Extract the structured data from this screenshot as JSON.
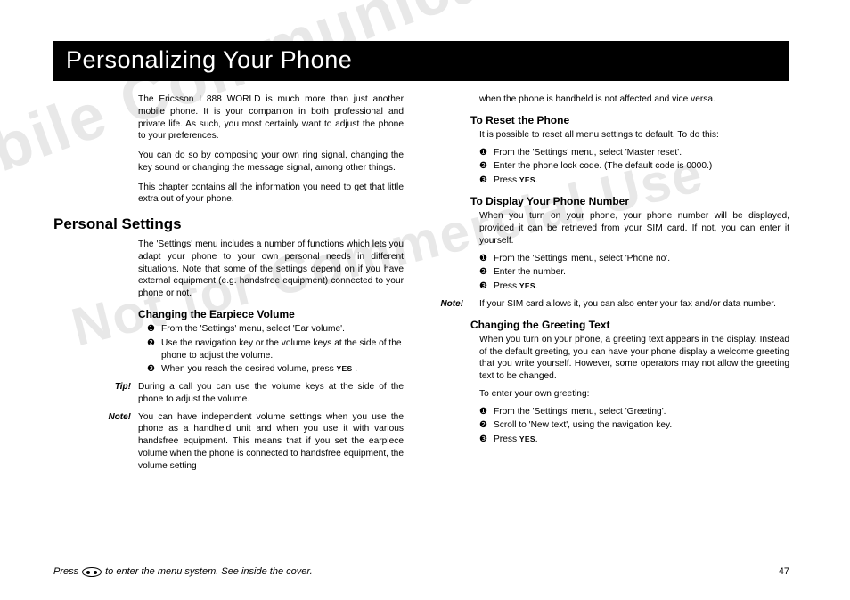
{
  "title": "Personalizing Your Phone",
  "watermark1": "Not for Commercial Use",
  "watermark2": "Ericsson Mobile Communications AB",
  "intro": [
    "The Ericsson I 888 WORLD is much more than just another mobile phone. It is your companion in both professional and private life. As such, you most certainly want to adjust the phone to your preferences.",
    "You can do so by composing your own ring signal, changing the key sound or changing the message signal, among other things.",
    "This chapter contains all the information you need to get that little extra out of your phone."
  ],
  "h2": "Personal Settings",
  "secdesc": "The 'Settings' menu includes a number of functions which lets you adapt your phone to your own personal needs in different situations. Note that some of the settings depend on if you have external equipment (e.g. handsfree equipment) connected to your phone or not.",
  "earpiece": {
    "h": "Changing the Earpiece Volume",
    "steps": [
      "From the 'Settings' menu, select 'Ear volume'.",
      "Use the navigation key or the volume keys at the side of the phone to adjust the volume.",
      "When you reach the desired volume, press YES ."
    ],
    "tip": "During a call you can use the volume keys at the side of the phone to adjust the volume.",
    "note": "You can have independent volume settings when you use the phone as a handheld unit and when you use it with various handsfree equipment. This means that if you set the earpiece volume when the phone is connected to handsfree equipment, the volume setting"
  },
  "right_cont": "when the phone is handheld is not affected and vice versa.",
  "reset": {
    "h": "To Reset the Phone",
    "p": "It is possible to reset all menu settings to default. To do this:",
    "steps": [
      "From the 'Settings' menu, select 'Master reset'.",
      "Enter the phone lock code. (The default code is 0000.)",
      "Press YES."
    ]
  },
  "display": {
    "h": "To Display Your Phone Number",
    "p": "When you turn on your phone, your phone number will be displayed, provided it can be retrieved from your SIM card. If not, you can enter it yourself.",
    "steps": [
      "From the 'Settings' menu, select 'Phone no'.",
      "Enter the number.",
      "Press YES."
    ],
    "note": "If your SIM card allows it, you can also enter your fax and/or data number."
  },
  "greeting": {
    "h": "Changing the Greeting Text",
    "p": "When you turn on your phone, a greeting text appears in the display. Instead of the default greeting, you can have your phone display a welcome greeting that you write yourself. However, some operators may not allow the greeting text to be changed.",
    "p2": "To enter your own greeting:",
    "steps": [
      "From the 'Settings' menu, select 'Greeting'.",
      "Scroll to 'New text', using the navigation key.",
      "Press YES."
    ]
  },
  "footer": {
    "left1": "Press",
    "left2": "to enter the menu system. See inside the cover.",
    "page": "47"
  },
  "labels": {
    "tip": "Tip!",
    "note": "Note!"
  },
  "nums": [
    "❶",
    "❷",
    "❸"
  ]
}
